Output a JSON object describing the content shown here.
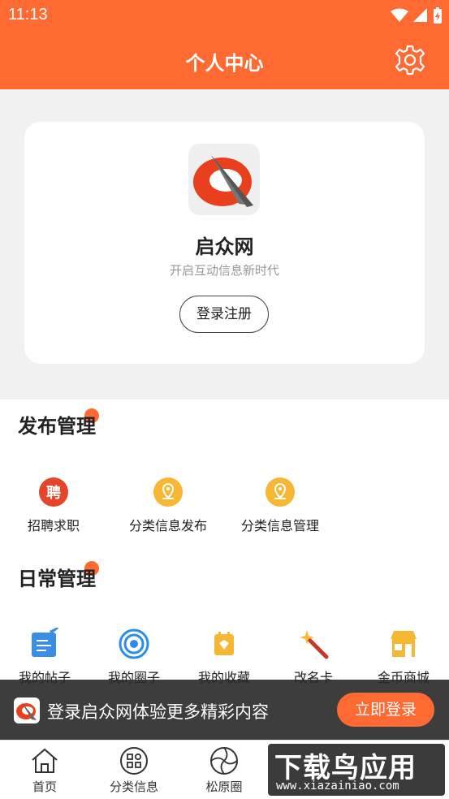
{
  "status_bar": {
    "time": "11:13"
  },
  "header": {
    "title": "个人中心"
  },
  "profile": {
    "app_name": "启众网",
    "slogan": "开启互动信息新时代",
    "login_label": "登录注册"
  },
  "publish_section": {
    "title": "发布管理",
    "items": [
      {
        "label": "招聘求职",
        "icon": "recruit-icon"
      },
      {
        "label": "分类信息发布",
        "icon": "location-pin-icon"
      },
      {
        "label": "分类信息管理",
        "icon": "location-pin-icon"
      }
    ]
  },
  "daily_section": {
    "title": "日常管理",
    "items": [
      {
        "label": "我的帖子",
        "icon": "post-edit-icon"
      },
      {
        "label": "我的圈子",
        "icon": "circle-icon"
      },
      {
        "label": "我的收藏",
        "icon": "favorite-icon"
      },
      {
        "label": "改名卡",
        "icon": "magic-wand-icon"
      },
      {
        "label": "金币商城",
        "icon": "shop-icon"
      }
    ]
  },
  "login_banner": {
    "text": "登录启众网体验更多精彩内容",
    "button": "立即登录"
  },
  "tabbar": {
    "items": [
      {
        "label": "首页",
        "icon": "home-icon"
      },
      {
        "label": "分类信息",
        "icon": "category-icon"
      },
      {
        "label": "松原圈",
        "icon": "aperture-icon"
      }
    ]
  },
  "watermark": {
    "main": "下载鸟应用",
    "sub": "www.xiazainiao.com"
  },
  "colors": {
    "accent": "#ff6a33",
    "banner_bg": "#282828"
  }
}
